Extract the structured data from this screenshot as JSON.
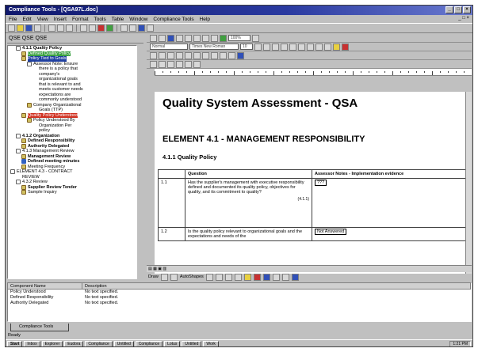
{
  "window": {
    "title": "Compliance Tools - [QSA97L.doc]",
    "controls": [
      "_",
      "□",
      "×"
    ]
  },
  "menu": [
    "File",
    "Edit",
    "View",
    "Insert",
    "Format",
    "Tools",
    "Table",
    "Window",
    "Compliance Tools",
    "Help"
  ],
  "menu_right": "_ □ ×",
  "left_panel": {
    "header": "QSE QSE QSE",
    "tree": [
      {
        "text": "4.1.1 Quality Policy",
        "icon": "plus",
        "indent": 1,
        "style": "bold"
      },
      {
        "text": "Defined Quality Policy",
        "icon": "doc",
        "indent": 2,
        "style": "hl-green"
      },
      {
        "text": "Policy Tied to Goals",
        "icon": "doc",
        "indent": 2,
        "style": "hl-blue"
      },
      {
        "text": "Assessor Note: Ensure",
        "icon": "plus",
        "indent": 3,
        "style": ""
      },
      {
        "text": "there is a policy that",
        "icon": "",
        "indent": 4,
        "style": ""
      },
      {
        "text": "company's",
        "icon": "",
        "indent": 4,
        "style": ""
      },
      {
        "text": "organizational goals",
        "icon": "",
        "indent": 4,
        "style": ""
      },
      {
        "text": "that is relevant to and",
        "icon": "",
        "indent": 4,
        "style": ""
      },
      {
        "text": "meets customer needs",
        "icon": "",
        "indent": 4,
        "style": ""
      },
      {
        "text": "expectations are",
        "icon": "",
        "indent": 4,
        "style": ""
      },
      {
        "text": "commonly understood",
        "icon": "",
        "indent": 4,
        "style": ""
      },
      {
        "text": "Company Organizational",
        "icon": "doc",
        "indent": 3,
        "style": ""
      },
      {
        "text": "Goals (TTP)",
        "icon": "",
        "indent": 4,
        "style": ""
      },
      {
        "text": "Quality Policy Understood",
        "icon": "doc",
        "indent": 2,
        "style": "hl-red"
      },
      {
        "text": "Policy Understood By",
        "icon": "doc",
        "indent": 3,
        "style": ""
      },
      {
        "text": "Organization Per",
        "icon": "",
        "indent": 4,
        "style": ""
      },
      {
        "text": "policy",
        "icon": "",
        "indent": 4,
        "style": ""
      },
      {
        "text": "4.1.2 Organization",
        "icon": "plus",
        "indent": 1,
        "style": "bold"
      },
      {
        "text": "Defined Responsibility",
        "icon": "doc",
        "indent": 2,
        "style": "bold"
      },
      {
        "text": "Authority Delegated",
        "icon": "doc",
        "indent": 2,
        "style": "bold"
      },
      {
        "text": "4.1.3 Management Review",
        "icon": "plus",
        "indent": 1,
        "style": ""
      },
      {
        "text": "Management Review",
        "icon": "doc",
        "indent": 2,
        "style": "bold"
      },
      {
        "text": "Defined meeting minutes",
        "icon": "blue",
        "indent": 2,
        "style": "bold"
      },
      {
        "text": "Meeting Frequency",
        "icon": "doc",
        "indent": 2,
        "style": ""
      },
      {
        "text": "ELEMENT 4.3 - CONTRACT",
        "icon": "plus",
        "indent": 0,
        "style": ""
      },
      {
        "text": "REVIEW",
        "icon": "",
        "indent": 1,
        "style": ""
      },
      {
        "text": "4.3.2 Review",
        "icon": "plus",
        "indent": 1,
        "style": ""
      },
      {
        "text": "Supplier Review Tender",
        "icon": "doc",
        "indent": 2,
        "style": "bold"
      },
      {
        "text": "Sample Inquiry",
        "icon": "doc",
        "indent": 2,
        "style": ""
      }
    ]
  },
  "doc": {
    "style_combo": "Normal",
    "font_combo": "Times New Roman",
    "size_combo": "10",
    "zoom": "100%",
    "title": "Quality System Assessment - QSA",
    "element": "ELEMENT 4.1 - MANAGEMENT RESPONSIBILITY",
    "section": "4.1.1 Quality Policy",
    "table": {
      "headers": [
        "",
        "Question",
        "Assessor Notes - Implementation evidence"
      ],
      "rows": [
        {
          "num": "1.1",
          "question": "Has the supplier's management with executive responsibility defined and documented its quality policy, objectives for quality, and its commitment to quality?",
          "ref": "(4.1.1)",
          "notes": "???"
        },
        {
          "num": "1.2",
          "question": "Is the quality policy relevant to organizational goals and the expectations and needs of the",
          "ref": "",
          "notes": "Not Answered"
        }
      ]
    },
    "hbar_label": "Draw",
    "drawbar_label": "AutoShapes"
  },
  "bottom_panel": {
    "headers": [
      "Component Name",
      "Description"
    ],
    "rows": [
      {
        "name": "Policy Understood",
        "desc": "No text specified."
      },
      {
        "name": "Defined Responsibility",
        "desc": "No text specified."
      },
      {
        "name": "Authority Delegated",
        "desc": "No text specified."
      }
    ],
    "tab": "Compliance Tools"
  },
  "status": "Ready",
  "taskbar": {
    "start": "Start",
    "tasks": [
      "Inbox",
      "Explorer",
      "Eudora",
      "Compliance",
      "Untitled",
      "Compliance",
      "Lotus",
      "Untitled",
      "Work"
    ],
    "clock": "1:21 PM"
  }
}
